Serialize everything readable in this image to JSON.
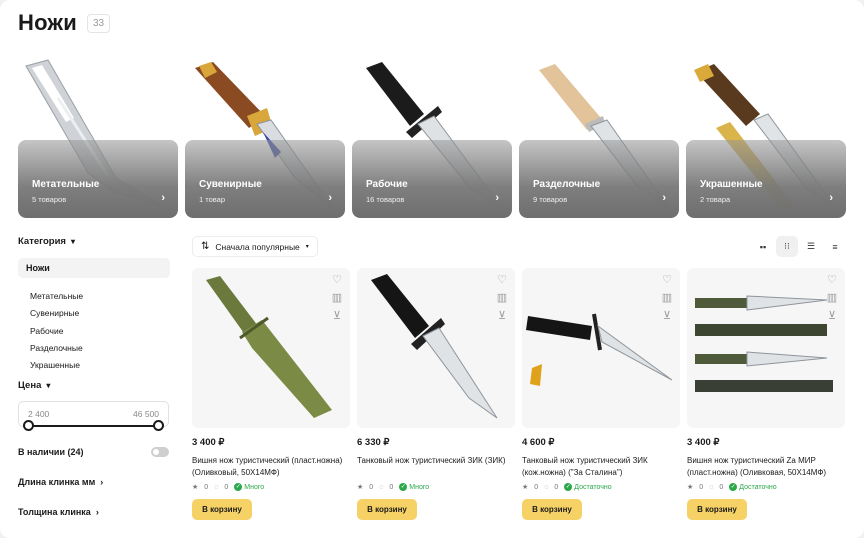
{
  "header": {
    "title": "Ножи",
    "count": "33"
  },
  "categories": [
    {
      "name": "Метательные",
      "count": "5 товаров"
    },
    {
      "name": "Сувенирные",
      "count": "1 товар"
    },
    {
      "name": "Рабочие",
      "count": "16 товаров"
    },
    {
      "name": "Разделочные",
      "count": "9 товаров"
    },
    {
      "name": "Украшенные",
      "count": "2 товара"
    }
  ],
  "sidebar": {
    "category_label": "Категория",
    "active_category": "Ножи",
    "subcategories": [
      "Метательные",
      "Сувенирные",
      "Рабочие",
      "Разделочные",
      "Украшенные"
    ],
    "price_label": "Цена",
    "price_min": "2 400",
    "price_max": "46 500",
    "in_stock_label": "В наличии (24)",
    "blade_length_label": "Длина клинка мм",
    "blade_thickness_label": "Толщина клинка"
  },
  "toolbar": {
    "sort_label": "Сначала популярные"
  },
  "products": [
    {
      "price": "3 400 ₽",
      "name": "Вишня нож туристический (пласт.ножна) (Оливковый, 50Х14МФ)",
      "rating": "0",
      "reviews": "0",
      "stock": "Много",
      "cart": "В корзину"
    },
    {
      "price": "6 330 ₽",
      "name": "Танковый нож туристический ЗИК (ЗИК)",
      "rating": "0",
      "reviews": "0",
      "stock": "Много",
      "cart": "В корзину"
    },
    {
      "price": "4 600 ₽",
      "name": "Танковый нож туристический ЗИК (кож.ножна) (\"За Сталина\")",
      "rating": "0",
      "reviews": "0",
      "stock": "Достаточно",
      "cart": "В корзину"
    },
    {
      "price": "3 400 ₽",
      "name": "Вишня нож туристический Za МИР (пласт.ножна) (Оливковая, 50Х14МФ)",
      "rating": "0",
      "reviews": "0",
      "stock": "Достаточно",
      "cart": "В корзину"
    }
  ],
  "icons": {
    "favorite": "heart-icon",
    "compare": "compare-icon",
    "cart": "cart-icon",
    "sort": "sort-icon",
    "chevron": "chevron-icon",
    "star": "star-icon",
    "comment": "comment-icon",
    "check": "check-icon"
  },
  "colors": {
    "accent": "#f6d266",
    "stock_green": "#2aa84a",
    "card_shade": "#8a8a8a"
  }
}
